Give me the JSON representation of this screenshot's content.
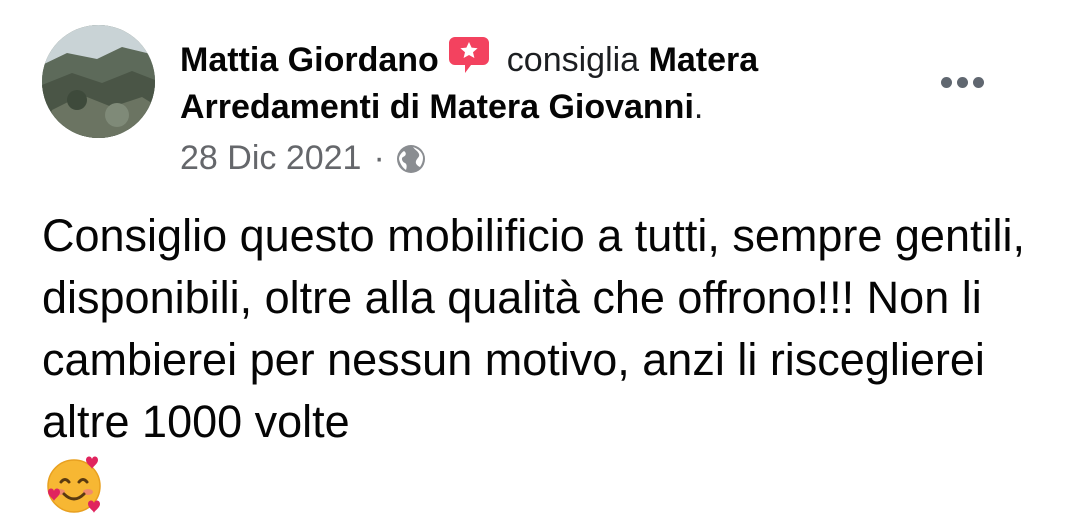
{
  "post": {
    "author_name": "Mattia Giordano",
    "action_text": "consiglia",
    "page_name": "Matera Arredamenti di Matera Giovanni",
    "trailing_period": ".",
    "date": "28 Dic 2021",
    "separator": "·",
    "privacy_icon": "globe-icon",
    "recommend_badge_icon": "recommend-badge-icon",
    "more_icon": "more-options-icon",
    "body": "Consiglio questo mobilificio a tutti, sempre gentili, disponibili, oltre alla qualità che offrono!!! Non li cambierei per nessun motivo, anzi li risceglierei altre 1000 volte",
    "emoji": "smiling-face-with-hearts-emoji"
  },
  "colors": {
    "badge": "#f3425f",
    "meta_text": "#65676b",
    "text": "#050505",
    "more_dots": "#606770"
  }
}
